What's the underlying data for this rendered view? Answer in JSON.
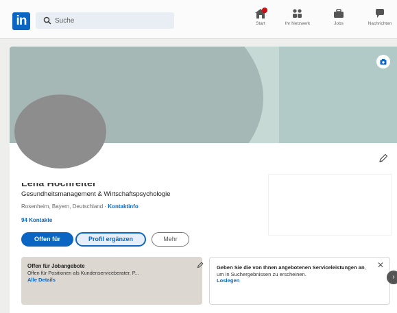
{
  "nav": {
    "logo_text": "in",
    "search_placeholder": "Suche",
    "items": [
      {
        "label": "Start",
        "icon": "home-icon"
      },
      {
        "label": "Ihr Netzwerk",
        "icon": "network-icon"
      },
      {
        "label": "Jobs",
        "icon": "briefcase-icon"
      },
      {
        "label": "Nachrichten",
        "icon": "messaging-icon"
      }
    ]
  },
  "profile": {
    "name": "Lena Hochreiter",
    "headline": "Gesundheitsmanagement & Wirtschaftspsychologie",
    "location": "Rosenheim, Bayern, Deutschland",
    "location_separator": " · ",
    "contact_info_link": "Kontaktinfo",
    "connections": "94 Kontakte"
  },
  "actions": {
    "open_to": "Offen für",
    "add_profile_section": "Profil ergänzen",
    "more": "Mehr"
  },
  "open_to_work": {
    "title": "Offen für Jobangebote",
    "description": "Offen für Positionen als Kundenserviceberater, P...",
    "link": "Alle Details"
  },
  "services": {
    "text_prefix": "Geben Sie die von Ihnen angebotenen Serviceleistungen an",
    "text_suffix": ", um in Suchergebnissen zu erscheinen.",
    "link": "Loslegen"
  },
  "colors": {
    "brand": "#0a66c2",
    "cover": "#c7d9d5",
    "avatar": "#8d8d8d",
    "notification": "#cc1016"
  }
}
